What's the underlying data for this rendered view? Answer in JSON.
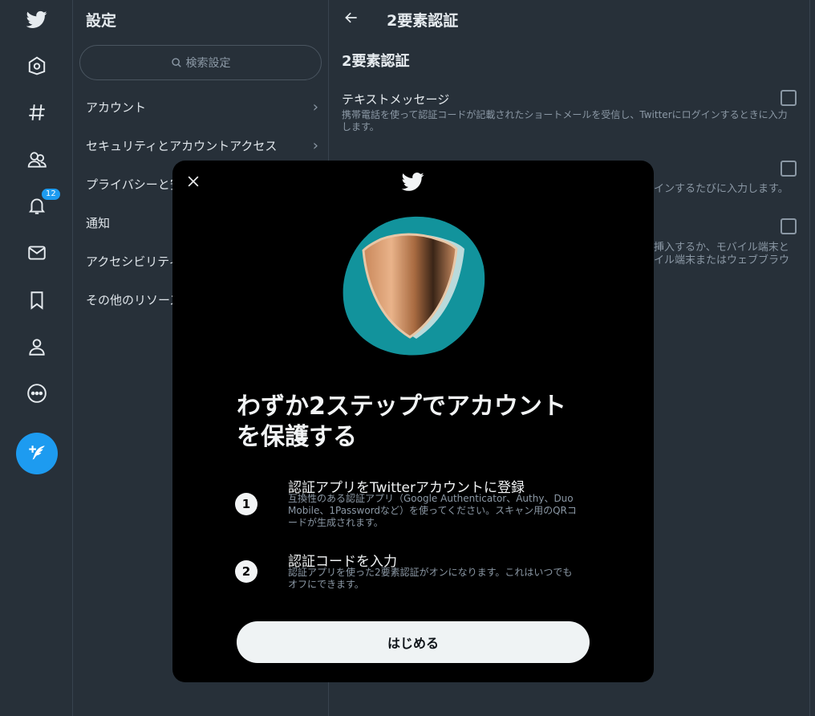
{
  "nav": {
    "items": [
      {
        "icon": "twitter-logo-icon"
      },
      {
        "icon": "home-icon"
      },
      {
        "icon": "explore-hashtag-icon"
      },
      {
        "icon": "communities-icon"
      },
      {
        "icon": "notifications-bell-icon",
        "badge": "12"
      },
      {
        "icon": "messages-envelope-icon"
      },
      {
        "icon": "bookmark-icon"
      },
      {
        "icon": "profile-icon"
      },
      {
        "icon": "more-icon"
      }
    ],
    "compose_icon": "compose-tweet-icon"
  },
  "settings": {
    "title": "設定",
    "search_placeholder": "検索設定",
    "items": [
      {
        "label": "アカウント",
        "chevron": "›"
      },
      {
        "label": "セキュリティとアカウントアクセス",
        "chevron": "›"
      },
      {
        "label": "プライバシーと安"
      },
      {
        "label": "通知"
      },
      {
        "label": "アクセシビリティ"
      },
      {
        "label": "その他のリソース"
      }
    ]
  },
  "detail": {
    "header_title": "2要素認証",
    "section_title": "2要素認証",
    "option1_title": "テキストメッセージ",
    "option1_desc": "携帯電話を使って認証コードが記載されたショートメールを受信し、Twitterにログインするときに入力します。",
    "option2_desc_fragment": "インするたびに入力します。",
    "option3_desc_fragment_1": "挿入するか、モバイル端末と",
    "option3_desc_fragment_2": "イル端末またはウェブブラウ"
  },
  "modal": {
    "heading": "わずか2ステップでアカウントを保護する",
    "steps": [
      {
        "number": "1",
        "title": "認証アプリをTwitterアカウントに登録",
        "desc": "互換性のある認証アプリ（Google Authenticator、Authy、Duo Mobile、1Passwordなど）を使ってください。スキャン用のQRコードが生成されます。"
      },
      {
        "number": "2",
        "title": "認証コードを入力",
        "desc": "認証アプリを使った2要素認証がオンになります。これはいつでもオフにできます。"
      }
    ],
    "start_label": "はじめる"
  },
  "colors": {
    "background": "#273039",
    "accent": "#1d9bf0",
    "modal_bg": "#000000",
    "button_bg": "#eff3f4",
    "hero_circle": "#12939c"
  }
}
